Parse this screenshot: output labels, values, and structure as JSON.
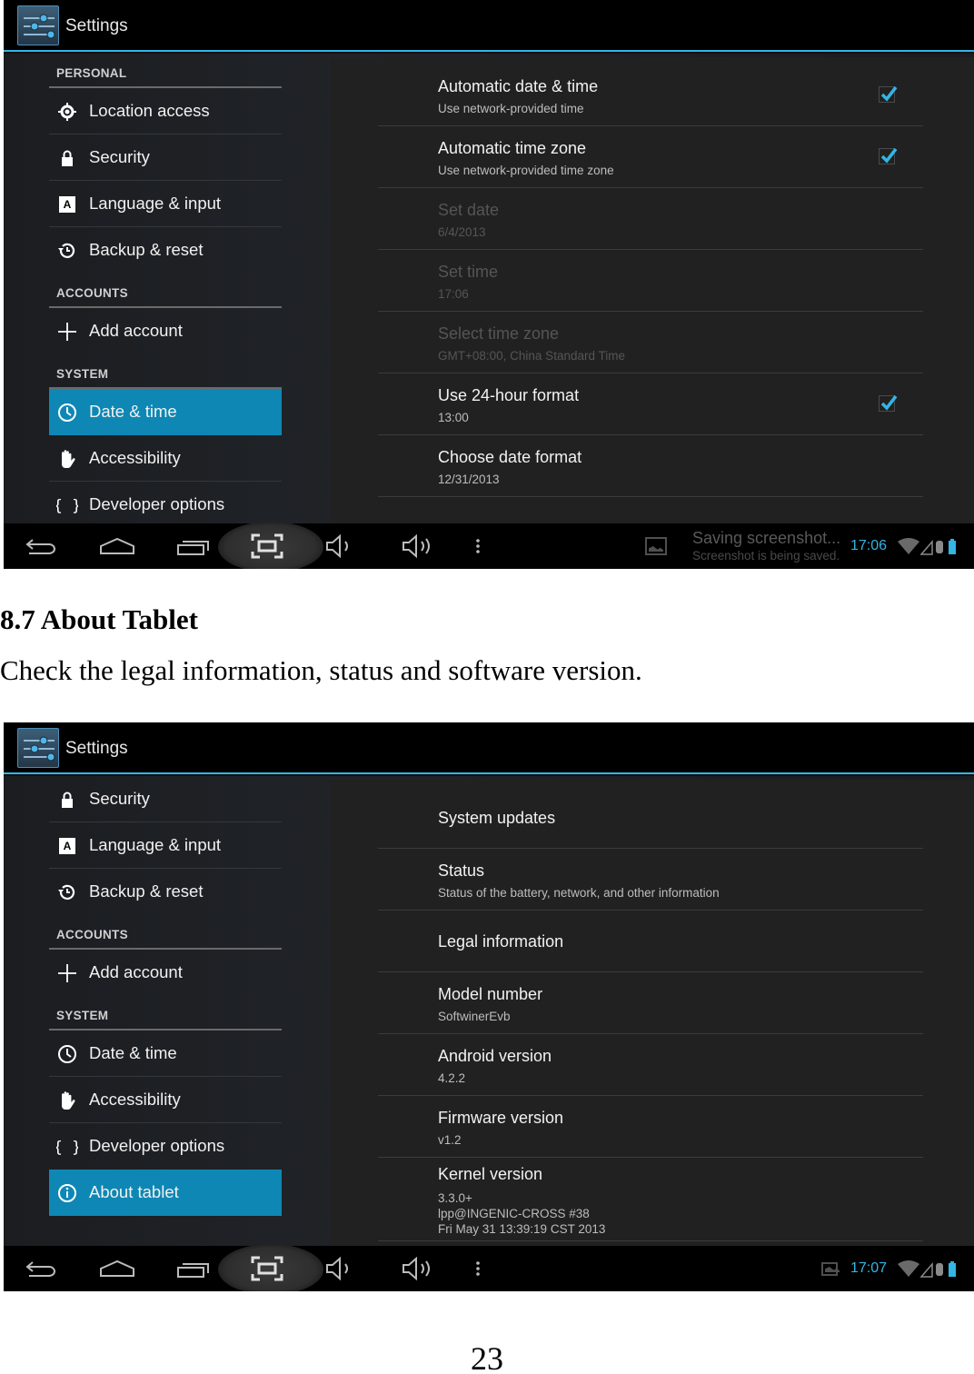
{
  "screenshot1": {
    "title": "Settings",
    "sidebar": [
      {
        "type": "header",
        "label": "PERSONAL"
      },
      {
        "type": "item",
        "icon": "location-icon",
        "label": "Location access"
      },
      {
        "type": "item",
        "icon": "lock-icon",
        "label": "Security"
      },
      {
        "type": "item",
        "icon": "language-icon",
        "label": "Language & input"
      },
      {
        "type": "item",
        "icon": "backup-icon",
        "label": "Backup & reset"
      },
      {
        "type": "header",
        "label": "ACCOUNTS"
      },
      {
        "type": "item",
        "icon": "plus-icon",
        "label": "Add account"
      },
      {
        "type": "header",
        "label": "SYSTEM"
      },
      {
        "type": "item",
        "icon": "clock-icon",
        "label": "Date & time",
        "selected": true
      },
      {
        "type": "item",
        "icon": "hand-icon",
        "label": "Accessibility"
      },
      {
        "type": "item",
        "icon": "braces-icon",
        "label": "Developer options"
      }
    ],
    "prefs": [
      {
        "title": "Automatic date & time",
        "summary": "Use network-provided time",
        "checked": true,
        "enabled": true
      },
      {
        "title": "Automatic time zone",
        "summary": "Use network-provided time zone",
        "checked": true,
        "enabled": true
      },
      {
        "title": "Set date",
        "summary": "6/4/2013",
        "enabled": false
      },
      {
        "title": "Set time",
        "summary": "17:06",
        "enabled": false
      },
      {
        "title": "Select time zone",
        "summary": "GMT+08:00, China Standard Time",
        "enabled": false
      },
      {
        "title": "Use 24-hour format",
        "summary": "13:00",
        "checked": true,
        "enabled": true
      },
      {
        "title": "Choose date format",
        "summary": "12/31/2013",
        "enabled": true
      }
    ],
    "status": {
      "notification_title": "Saving screenshot...",
      "notification_text": "Screenshot is being saved.",
      "clock": "17:06"
    }
  },
  "document": {
    "heading": "8.7 About Tablet",
    "paragraph": "Check the legal information, status and software version.",
    "page_number": "23"
  },
  "screenshot2": {
    "title": "Settings",
    "sidebar": [
      {
        "type": "item",
        "icon": "lock-icon",
        "label": "Security"
      },
      {
        "type": "item",
        "icon": "language-icon",
        "label": "Language & input"
      },
      {
        "type": "item",
        "icon": "backup-icon",
        "label": "Backup & reset"
      },
      {
        "type": "header",
        "label": "ACCOUNTS"
      },
      {
        "type": "item",
        "icon": "plus-icon",
        "label": "Add account"
      },
      {
        "type": "header",
        "label": "SYSTEM"
      },
      {
        "type": "item",
        "icon": "clock-icon",
        "label": "Date & time"
      },
      {
        "type": "item",
        "icon": "hand-icon",
        "label": "Accessibility"
      },
      {
        "type": "item",
        "icon": "braces-icon",
        "label": "Developer options"
      },
      {
        "type": "item",
        "icon": "info-icon",
        "label": "About tablet",
        "selected": true
      }
    ],
    "prefs": [
      {
        "title": "System updates",
        "summary": ""
      },
      {
        "title": "Status",
        "summary": "Status of the battery, network, and other information"
      },
      {
        "title": "Legal information",
        "summary": ""
      },
      {
        "title": "Model number",
        "summary": "SoftwinerEvb"
      },
      {
        "title": "Android version",
        "summary": "4.2.2"
      },
      {
        "title": "Firmware version",
        "summary": "v1.2"
      },
      {
        "title": "Kernel version",
        "summary_lines": [
          "3.3.0+",
          "lpp@INGENIC-CROSS #38",
          "Fri May 31 13:39:19 CST 2013"
        ]
      }
    ],
    "status": {
      "clock": "17:07"
    }
  },
  "colors": {
    "accent": "#33b5e5",
    "selected": "#0e87b4",
    "check": "#33b5e5"
  }
}
